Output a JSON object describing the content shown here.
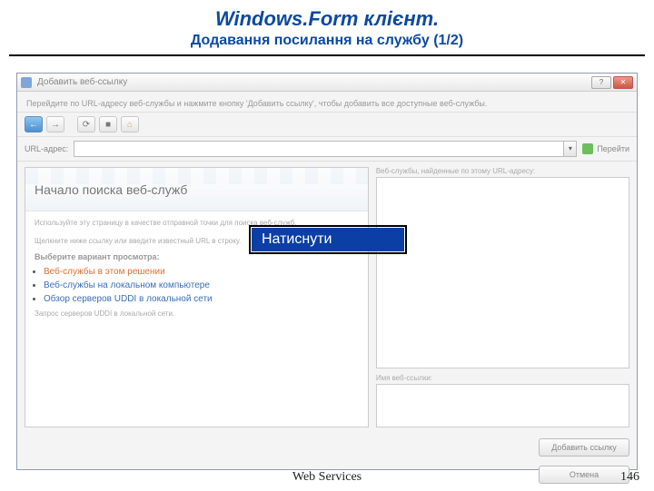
{
  "slide": {
    "title_main": "Windows.Form клієнт.",
    "title_sub": "Додавання посилання на службу (1/2)",
    "footer": "Web Services",
    "number": "146"
  },
  "callout": {
    "text": "Натиснути"
  },
  "dialog": {
    "title": "Добавить веб-ссылку",
    "instruction": "Перейдите по URL-адресу веб-службы и нажмите кнопку 'Добавить ссылку', чтобы добавить все доступные веб-службы.",
    "winbtns": {
      "help": "?",
      "close": "✕"
    },
    "nav": {
      "back_glyph": "←",
      "fwd_glyph": "→",
      "refresh_glyph": "⟳",
      "stop_glyph": "■",
      "home_glyph": "⌂"
    },
    "url": {
      "label": "URL-адрес:",
      "value": "",
      "dropdown_glyph": "▾",
      "go_label": "Перейти"
    },
    "left": {
      "banner_title": "Начало поиска веб-служб",
      "desc_1": "Используйте эту страницу в качестве отправной точки для поиска веб-служб.",
      "desc_2": "Щелкните ниже ссылку или введите известный URL в строку.",
      "options_label": "Выберите вариант просмотра:",
      "items": [
        "Веб-службы в этом решении",
        "Веб-службы на локальном компьютере",
        "Обзор серверов UDDI в локальной сети"
      ],
      "note": "Запрос серверов UDDI в локальной сети."
    },
    "right": {
      "list_label": "Веб-службы, найденные по этому URL-адресу:",
      "ref_name_label": "Имя веб-ссылки:"
    },
    "buttons": {
      "add": "Добавить ссылку",
      "cancel": "Отмена"
    }
  }
}
